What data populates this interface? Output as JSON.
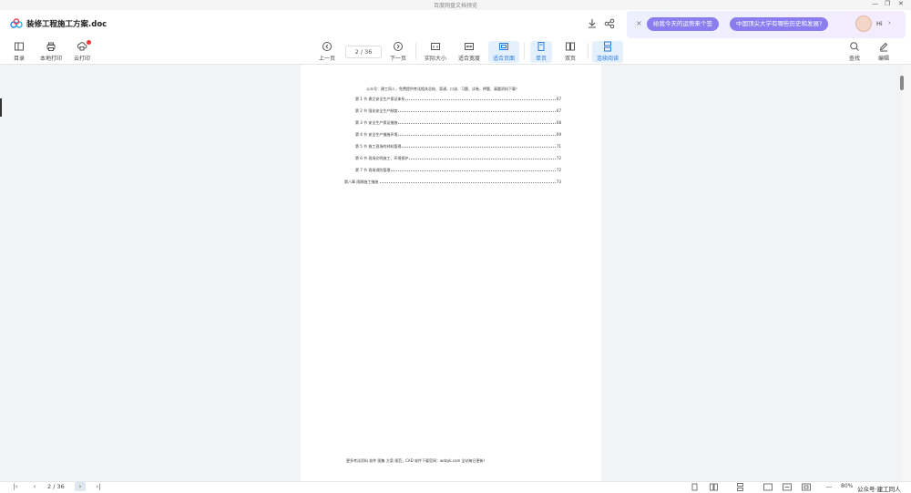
{
  "window": {
    "title": "百度网盘文档预览",
    "minimize": "—",
    "restore": "❐",
    "close": "✕"
  },
  "header": {
    "doc_name": "装修工程施工方案.doc",
    "download_icon": "download-icon",
    "share_icon": "share-icon"
  },
  "ai_panel": {
    "close": "×",
    "chip1": "给我今天的运势来个签",
    "chip2": "中国顶尖大学有哪些历史和发展?",
    "greeting": "Hi",
    "arrow": "›"
  },
  "toolbar": {
    "toc": "目录",
    "local_print": "本地打印",
    "cloud_print": "云打印",
    "prev_page": "上一页",
    "page_indicator": "2 / 36",
    "next_page": "下一页",
    "actual_size": "实际大小",
    "fit_width": "适合宽度",
    "fit_page": "适合页面",
    "single_page": "单页",
    "double_page": "双页",
    "continuous": "连续阅读",
    "search": "查找",
    "edit": "编辑"
  },
  "document": {
    "notice": "公众号：建工同人，免费提供考试相关总结、背诵、口诀、习题、试卷、押题、真题资料下载！",
    "toc": [
      {
        "title": "第 1 节  建立安全生产保证体系",
        "page": "67"
      },
      {
        "title": "第 2 节  强化安全生产制度",
        "page": "67"
      },
      {
        "title": "第 3 节  安全生产保证措施",
        "page": "68"
      },
      {
        "title": "第 4 节  安全生产措施环境",
        "page": "69"
      },
      {
        "title": "第 5 节  施工现场的材料管理",
        "page": "71"
      },
      {
        "title": "第 6 节  现场文明施工、环境保护",
        "page": "72"
      },
      {
        "title": "第 7 节  现场消防管理",
        "page": "72"
      },
      {
        "title": "第八章  雨期施工措施",
        "page": "73"
      }
    ],
    "footer": "更多考试资料 软件 图集 方案 规范，CAD 软件下载官网：wdzyk.com 全站每日更新！"
  },
  "statusbar": {
    "first": "|‹",
    "prev": "‹",
    "page": "2 / 36",
    "next": "›",
    "last": "›|",
    "zoom_out": "—",
    "zoom": "80%",
    "watermark": "公众号·建工同人"
  },
  "colors": {
    "accent": "#2a7be0",
    "active_bg": "#e4f1fd",
    "ai_chip": "#8b7df0",
    "badge": "#f0373c"
  }
}
